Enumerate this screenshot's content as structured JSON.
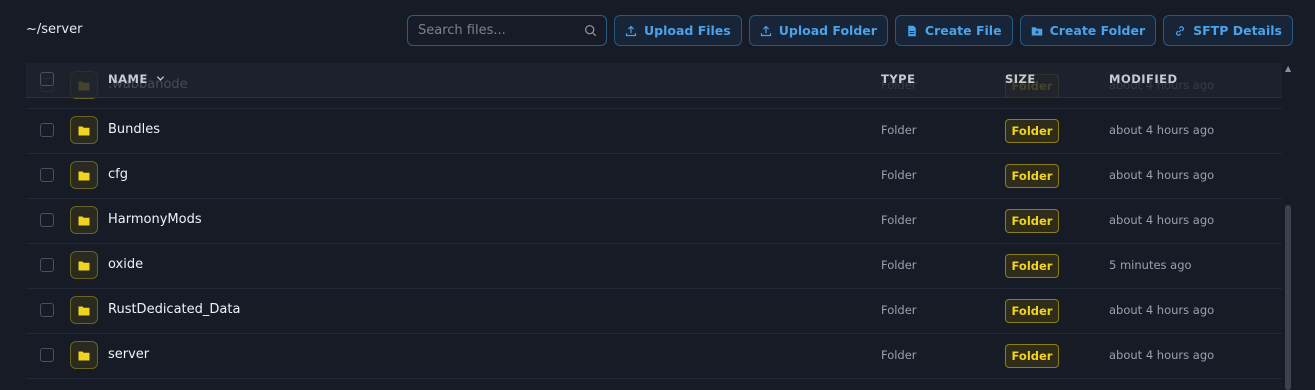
{
  "path": "~/server",
  "search": {
    "placeholder": "Search files..."
  },
  "toolbar": {
    "upload_files": "Upload Files",
    "upload_folder": "Upload Folder",
    "create_file": "Create File",
    "create_folder": "Create Folder",
    "sftp_details": "SFTP Details"
  },
  "table": {
    "columns": {
      "name": "NAME",
      "type": "TYPE",
      "size": "SIZE",
      "modified": "MODIFIED"
    },
    "rows": [
      {
        "name": ".wabbanode",
        "type": "Folder",
        "size": "Folder",
        "modified": "about 4 hours ago"
      },
      {
        "name": "Bundles",
        "type": "Folder",
        "size": "Folder",
        "modified": "about 4 hours ago"
      },
      {
        "name": "cfg",
        "type": "Folder",
        "size": "Folder",
        "modified": "about 4 hours ago"
      },
      {
        "name": "HarmonyMods",
        "type": "Folder",
        "size": "Folder",
        "modified": "about 4 hours ago"
      },
      {
        "name": "oxide",
        "type": "Folder",
        "size": "Folder",
        "modified": "5 minutes ago"
      },
      {
        "name": "RustDedicated_Data",
        "type": "Folder",
        "size": "Folder",
        "modified": "about 4 hours ago"
      },
      {
        "name": "server",
        "type": "Folder",
        "size": "Folder",
        "modified": "about 4 hours ago"
      }
    ]
  },
  "colors": {
    "accent": "#4aa3e8",
    "folder": "#f1d41f",
    "background": "#171b26"
  }
}
